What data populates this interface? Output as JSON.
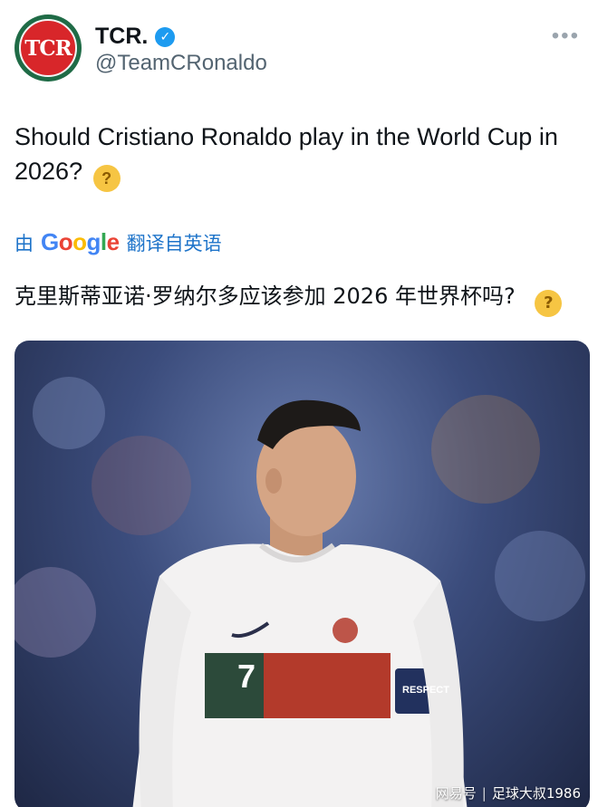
{
  "account": {
    "display_name": "TCR.",
    "handle": "@TeamCRonaldo",
    "avatar_text": "TCR",
    "verified_icon": "verified-badge-icon",
    "more_icon": "more-options-icon",
    "more_glyph": "•••"
  },
  "tweet": {
    "text": "Should Cristiano Ronaldo play in the World Cup in 2026?",
    "emoji": "thinking-face"
  },
  "translation": {
    "prefix": "由",
    "provider": "Google",
    "suffix": "翻译自英语",
    "translated_text": "克里斯蒂亚诺·罗纳尔多应该参加 2026 年世界杯吗?"
  },
  "media": {
    "jersey_number": "7",
    "armband_text": "RESPECT",
    "watermark_source": "网易号",
    "watermark_separator": "|",
    "watermark_author": "足球大叔1986"
  },
  "colors": {
    "accent_blue": "#1d9bf0",
    "avatar_red": "#d8262a",
    "avatar_green": "#1f6b46"
  }
}
